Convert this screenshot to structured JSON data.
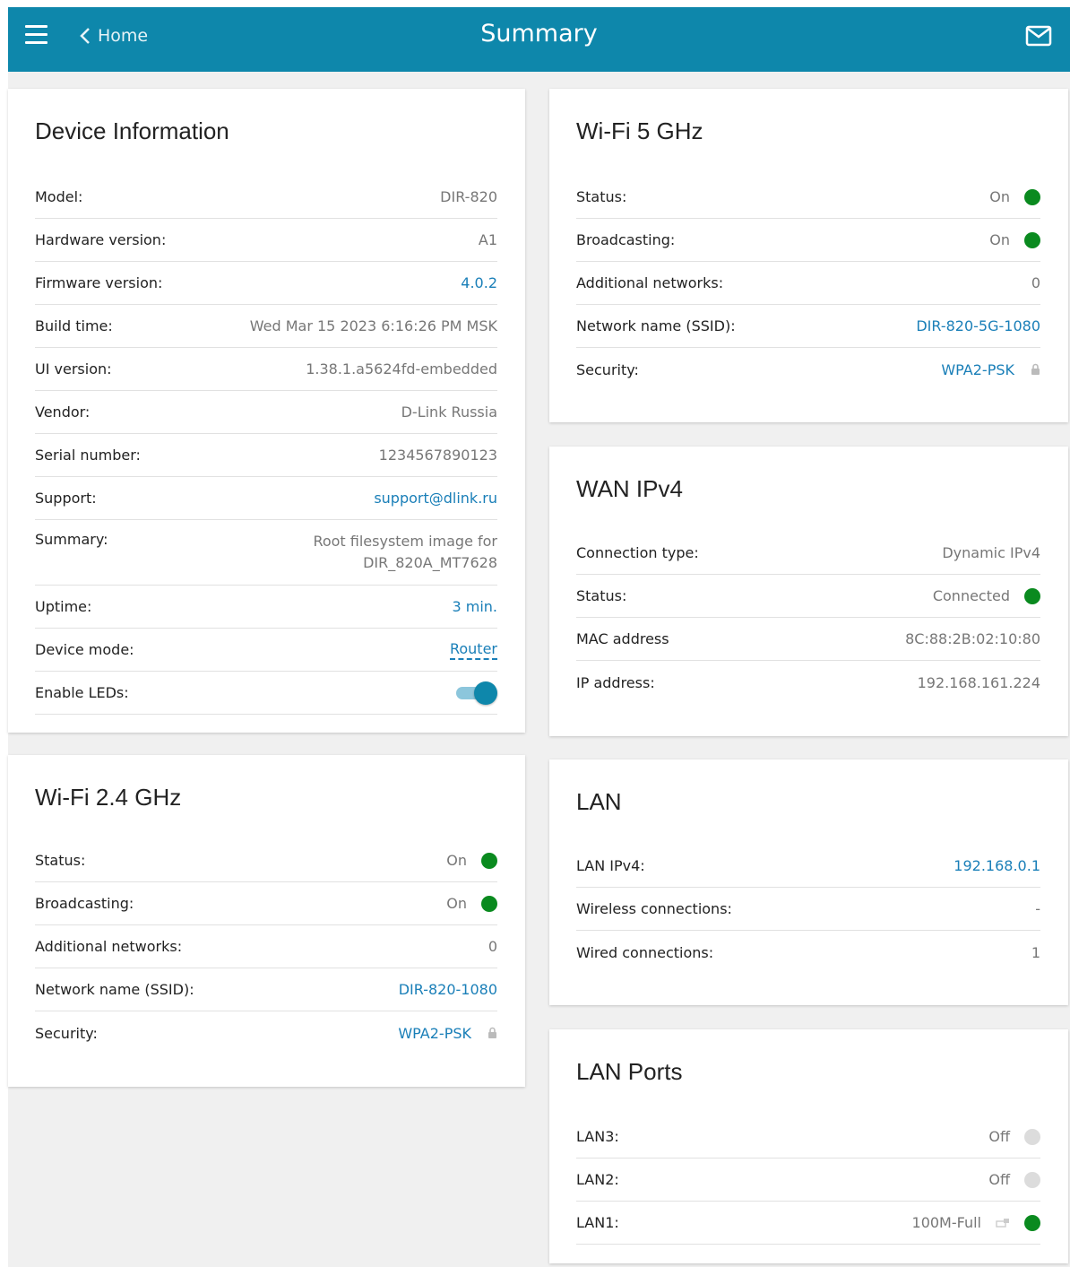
{
  "header": {
    "back_label": "Home",
    "title": "Summary"
  },
  "device_info": {
    "title": "Device Information",
    "rows": [
      {
        "label": "Model:",
        "value": "DIR-820"
      },
      {
        "label": "Hardware version:",
        "value": "A1"
      },
      {
        "label": "Firmware version:",
        "value": "4.0.2"
      },
      {
        "label": "Build time:",
        "value": "Wed Mar 15 2023 6:16:26 PM MSK"
      },
      {
        "label": "UI version:",
        "value": "1.38.1.a5624fd-embedded"
      },
      {
        "label": "Vendor:",
        "value": "D-Link Russia"
      },
      {
        "label": "Serial number:",
        "value": "1234567890123"
      },
      {
        "label": "Support:",
        "value": "support@dlink.ru"
      },
      {
        "label": "Summary:",
        "value_line1": "Root filesystem image for",
        "value_line2": "DIR_820A_MT7628"
      },
      {
        "label": "Uptime:",
        "value": "3 min."
      },
      {
        "label": "Device mode:",
        "value": "Router"
      },
      {
        "label": "Enable LEDs:",
        "enabled": true
      }
    ]
  },
  "wifi24": {
    "title": "Wi-Fi 2.4 GHz",
    "rows": [
      {
        "label": "Status:",
        "value": "On"
      },
      {
        "label": "Broadcasting:",
        "value": "On"
      },
      {
        "label": "Additional networks:",
        "value": "0"
      },
      {
        "label": "Network name (SSID):",
        "value": "DIR-820-1080"
      },
      {
        "label": "Security:",
        "value": "WPA2-PSK"
      }
    ]
  },
  "wifi5": {
    "title": "Wi-Fi 5 GHz",
    "rows": [
      {
        "label": "Status:",
        "value": "On"
      },
      {
        "label": "Broadcasting:",
        "value": "On"
      },
      {
        "label": "Additional networks:",
        "value": "0"
      },
      {
        "label": "Network name (SSID):",
        "value": "DIR-820-5G-1080"
      },
      {
        "label": "Security:",
        "value": "WPA2-PSK"
      }
    ]
  },
  "wan": {
    "title": "WAN IPv4",
    "rows": [
      {
        "label": "Connection type:",
        "value": "Dynamic IPv4"
      },
      {
        "label": "Status:",
        "value": "Connected"
      },
      {
        "label": "MAC address",
        "value": "8C:88:2B:02:10:80"
      },
      {
        "label": "IP address:",
        "value": "192.168.161.224"
      }
    ]
  },
  "lan": {
    "title": "LAN",
    "rows": [
      {
        "label": "LAN IPv4:",
        "value": "192.168.0.1"
      },
      {
        "label": "Wireless connections:",
        "value": "-"
      },
      {
        "label": "Wired connections:",
        "value": "1"
      }
    ]
  },
  "lan_ports": {
    "title": "LAN Ports",
    "rows": [
      {
        "label": "LAN3:",
        "value": "Off"
      },
      {
        "label": "LAN2:",
        "value": "Off"
      },
      {
        "label": "LAN1:",
        "value": "100M-Full"
      }
    ]
  },
  "colors": {
    "header": "#0e87ab",
    "link": "#1a7fb8",
    "status_on": "#0a8a1f",
    "status_off": "#dcdcdc"
  },
  "icons": [
    "menu-icon",
    "chevron-left-icon",
    "mail-icon",
    "lock-icon",
    "ethernet-icon"
  ]
}
